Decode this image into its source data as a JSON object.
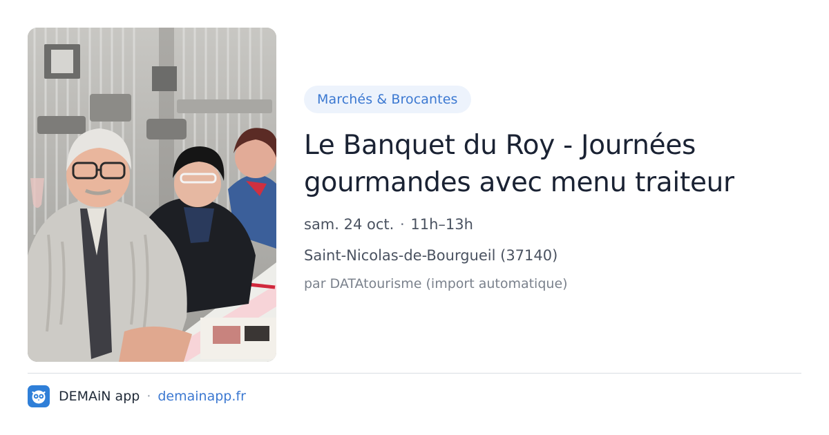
{
  "photo": {
    "icon": "event-photo"
  },
  "event": {
    "category": "Marchés & Brocantes",
    "title_line1": "Le Banquet du Roy - Journées",
    "title_line2": "gourmandes avec menu traiteur",
    "date": "sam. 24 oct.",
    "separator": "·",
    "time": "11h–13h",
    "location": "Saint-Nicolas-de-Bourgueil (37140)",
    "source": "par DATAtourisme (import automatique)"
  },
  "footer": {
    "app_name": "DEMAiN app",
    "separator": "·",
    "domain": "demainapp.fr",
    "icon": "demain-app-icon"
  },
  "colors": {
    "accent": "#3b78d1",
    "badge_bg": "#edf3fc",
    "title": "#1a2233",
    "muted": "#7a818c"
  }
}
